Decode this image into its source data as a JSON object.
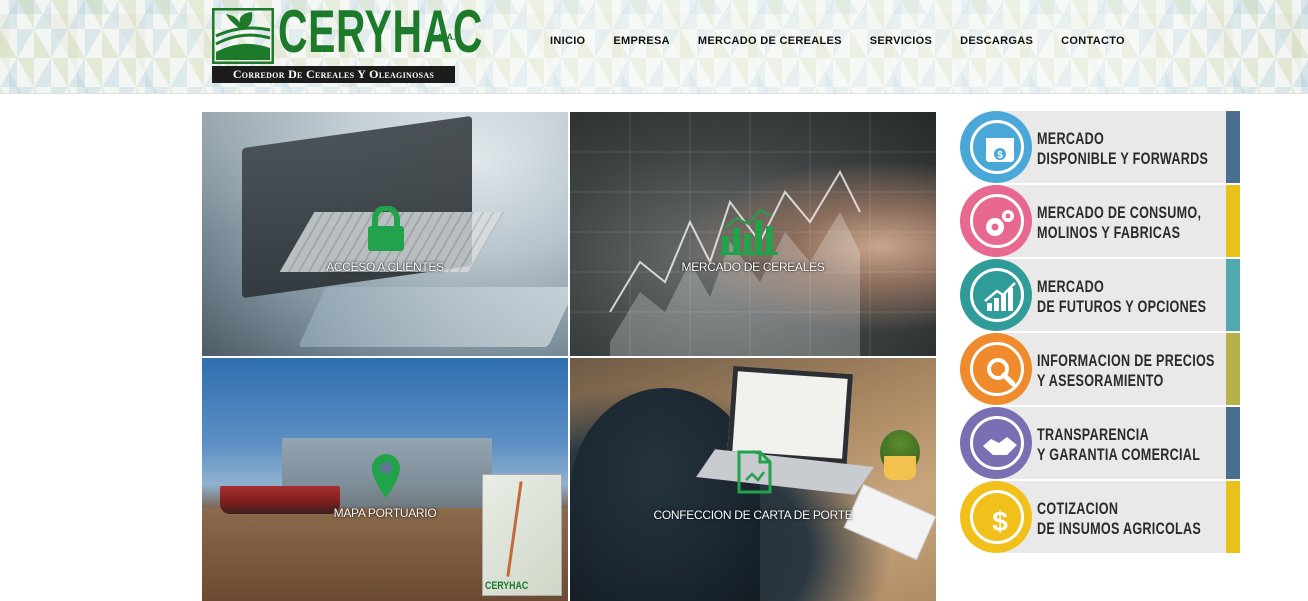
{
  "brand": {
    "name": "CERYHAC",
    "suffix": "S.A.",
    "tagline": "Corredor De Cereales Y Oleaginosas"
  },
  "nav": {
    "items": [
      {
        "label": "INICIO"
      },
      {
        "label": "EMPRESA"
      },
      {
        "label": "MERCADO DE CEREALES"
      },
      {
        "label": "SERVICIOS"
      },
      {
        "label": "DESCARGAS"
      },
      {
        "label": "CONTACTO"
      }
    ]
  },
  "tiles": [
    {
      "label": "ACCESO A CLIENTES",
      "icon": "lock-icon"
    },
    {
      "label": "MERCADO DE CEREALES",
      "icon": "bar-chart-icon"
    },
    {
      "label": "MAPA PORTUARIO",
      "icon": "map-pin-icon",
      "map_logo": "CERYHAC"
    },
    {
      "label": "CONFECCION DE CARTA DE PORTE",
      "icon": "document-icon"
    }
  ],
  "services": [
    {
      "line1": "MERCADO",
      "line2": "DISPONIBLE Y FORWARDS",
      "icon": "calendar-dollar-icon",
      "ring_color": "#4aa8d8",
      "bar_color": "#4a6f8e"
    },
    {
      "line1": "MERCADO DE CONSUMO,",
      "line2": "MOLINOS Y FABRICAS",
      "icon": "gears-icon",
      "ring_color": "#e8698f",
      "bar_color": "#e8c21a"
    },
    {
      "line1": "MERCADO",
      "line2": "DE FUTUROS Y OPCIONES",
      "icon": "growth-chart-icon",
      "ring_color": "#2f9c9a",
      "bar_color": "#4fa9ad"
    },
    {
      "line1": "INFORMACION DE PRECIOS",
      "line2": "Y ASESORAMIENTO",
      "icon": "magnifier-icon",
      "ring_color": "#ef8b2c",
      "bar_color": "#b7b14a"
    },
    {
      "line1": "TRANSPARENCIA",
      "line2": "Y GARANTIA COMERCIAL",
      "icon": "handshake-icon",
      "ring_color": "#7a6fb3",
      "bar_color": "#4a6f8e"
    },
    {
      "line1": "COTIZACION",
      "line2": "DE INSUMOS AGRICOLAS",
      "icon": "dollar-coin-icon",
      "ring_color": "#f2c01a",
      "bar_color": "#e8c21a"
    }
  ],
  "colors": {
    "brand_green": "#1d7a2a",
    "icon_green": "#22a24a"
  }
}
